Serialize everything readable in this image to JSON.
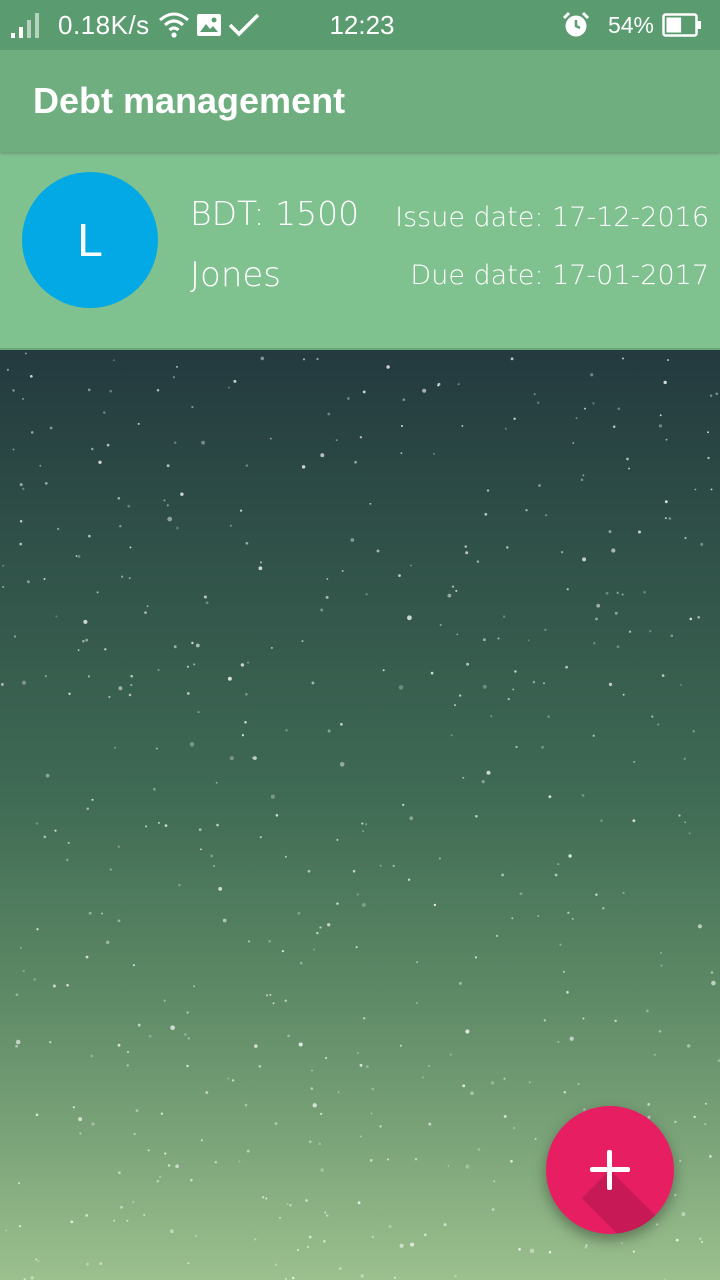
{
  "status_bar": {
    "net_speed": "0.18K/s",
    "time": "12:23",
    "battery_percent": "54%",
    "battery_level": 0.54,
    "icons": [
      "signal-icon",
      "wifi-icon",
      "image-icon",
      "check-icon",
      "alarm-icon",
      "battery-icon"
    ]
  },
  "app_bar": {
    "title": "Debt management"
  },
  "debts": [
    {
      "avatar_letter": "L",
      "amount": "BDT: 1500",
      "name": "Jones",
      "issue_date": "Issue date: 17-12-2016",
      "due_date": "Due date: 17-01-2017"
    }
  ],
  "fab": {
    "icon": "plus-icon"
  },
  "colors": {
    "status_bar": "#5a9b6f",
    "app_bar": "#6fae7f",
    "card": "#80c190",
    "avatar": "#03a9e4",
    "fab": "#e81e63"
  }
}
